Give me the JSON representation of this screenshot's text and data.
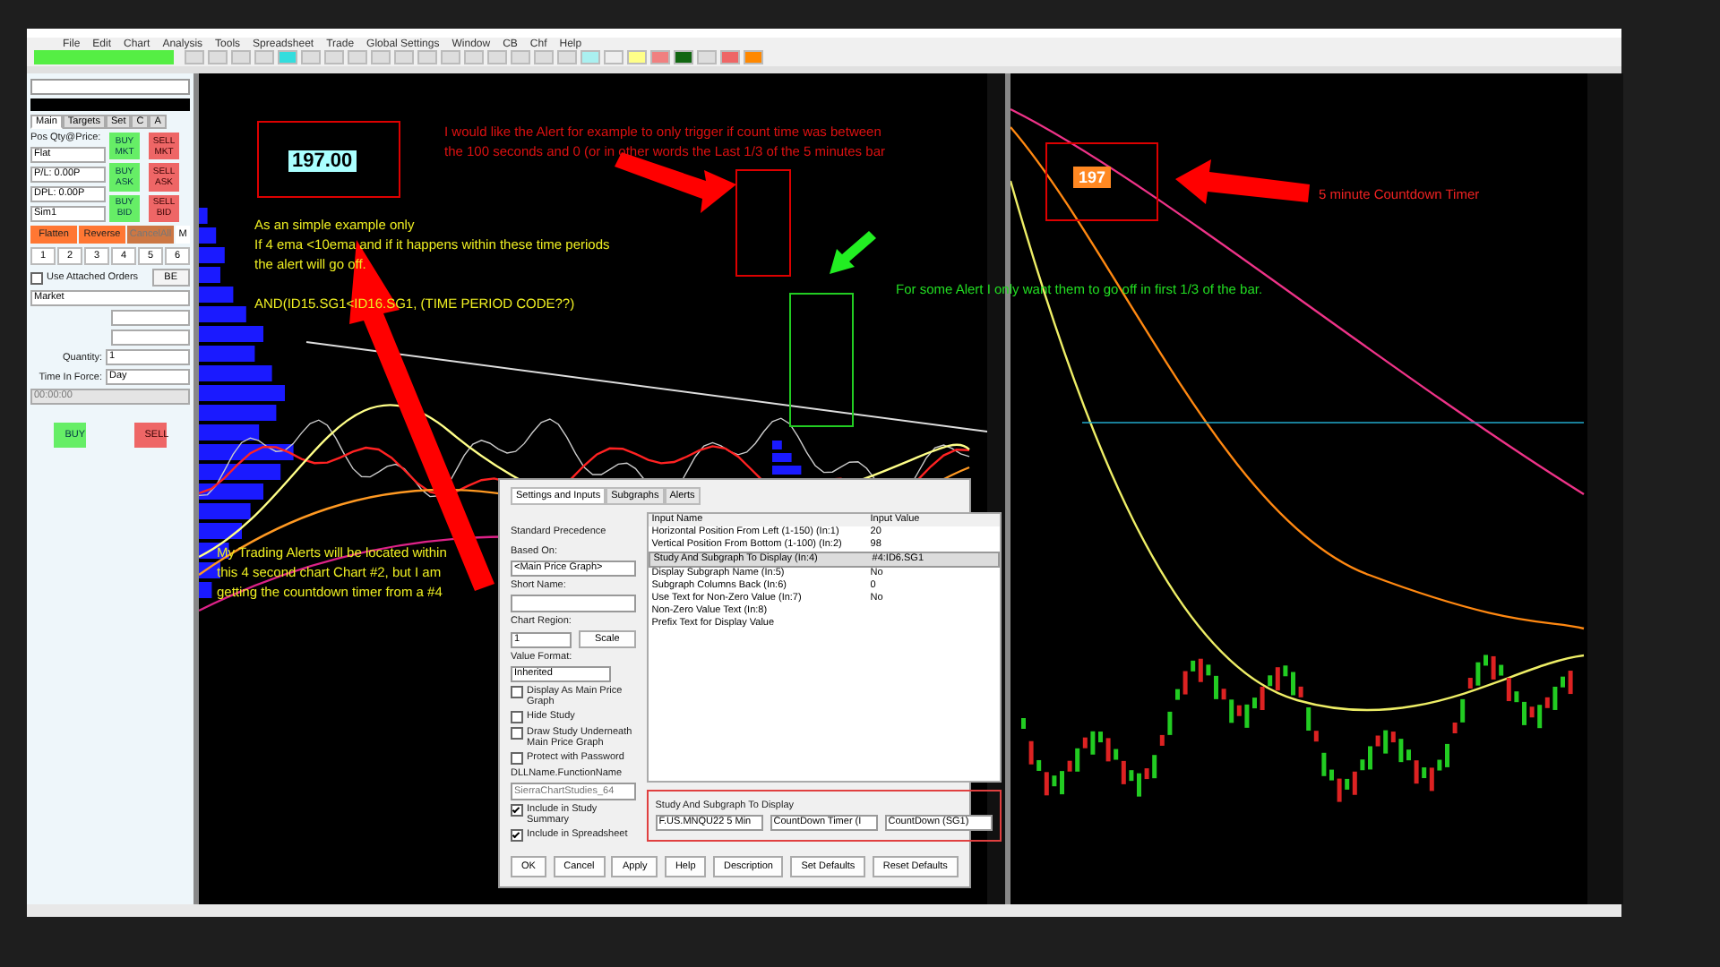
{
  "menu": [
    "File",
    "Edit",
    "Chart",
    "Analysis",
    "Tools",
    "Spreadsheet",
    "Trade",
    "Global Settings",
    "Window",
    "CB",
    "Chf",
    "Help"
  ],
  "order_panel": {
    "tabs": [
      {
        "label": "Main",
        "selected": true
      },
      {
        "label": "Targets",
        "selected": false
      },
      {
        "label": "Set",
        "selected": false
      },
      {
        "label": "C",
        "selected": false
      },
      {
        "label": "A",
        "selected": false
      }
    ],
    "position_label": "Pos Qty@Price:",
    "position_value": "Flat",
    "pl": "P/L: 0.00P",
    "dpl": "DPL: 0.00P",
    "account": "Sim1",
    "trade_buttons": [
      {
        "label": "BUY MKT",
        "kind": "buy"
      },
      {
        "label": "SELL MKT",
        "kind": "sell"
      },
      {
        "label": "BUY ASK",
        "kind": "buy"
      },
      {
        "label": "SELL ASK",
        "kind": "sell"
      },
      {
        "label": "BUY BID",
        "kind": "buy"
      },
      {
        "label": "SELL BID",
        "kind": "sell"
      }
    ],
    "actions": [
      "Flatten",
      "Reverse",
      "CancelAll",
      "M"
    ],
    "numbers": [
      "1",
      "2",
      "3",
      "4",
      "5",
      "6"
    ],
    "attached_orders": {
      "label": "Use Attached Orders",
      "checked": false
    },
    "be": "BE",
    "order_type": "Market",
    "quantity_label": "Quantity:",
    "quantity": "1",
    "tif_label": "Time In Force:",
    "tif": "Day",
    "time": "00:00:00",
    "buy": "BUY",
    "sell": "SELL"
  },
  "left_chart": {
    "price_box": "197.00",
    "note_top": [
      "I would like the Alert for example to only trigger if count time was between",
      "the 100 seconds and 0 (or in other words the Last 1/3 of the 5 minutes bar"
    ],
    "note_example": [
      "As an simple example only",
      "If 4 ema <10ema and if  it happens within these time periods",
      "the alert will go off."
    ],
    "formula": "AND(ID15.SG1<ID16.SG1, (TIME PERIOD CODE??)",
    "note_bottom": [
      "My Trading Alerts will be located within",
      "this 4 second chart Chart #2,  but I am",
      "getting the countdown timer from a #4"
    ]
  },
  "green_note": "For some Alert I only want them to go off in first 1/3 of the bar.",
  "right_chart": {
    "timer": "197",
    "timer_note": "5 minute Countdown Timer"
  },
  "dialog": {
    "tabs": [
      {
        "label": "Settings and Inputs",
        "selected": true
      },
      {
        "label": "Subgraphs",
        "selected": false
      },
      {
        "label": "Alerts",
        "selected": false
      }
    ],
    "precedence": "Standard Precedence",
    "based_on_label": "Based On:",
    "based_on": "<Main Price Graph>",
    "short_name_label": "Short Name:",
    "region_label": "Chart Region:",
    "region": "1",
    "scale": "Scale",
    "format_label": "Value Format:",
    "format": "Inherited",
    "options": [
      {
        "label": "Display As Main Price Graph",
        "checked": false
      },
      {
        "label": "Hide Study",
        "checked": false
      },
      {
        "label": "Draw Study Underneath Main Price Graph",
        "checked": false
      },
      {
        "label": "Protect with Password",
        "checked": false
      }
    ],
    "dll_label": "DLLName.FunctionName",
    "dll": "SierraChartStudies_64",
    "includes": [
      {
        "label": "Include in Study Summary",
        "checked": true
      },
      {
        "label": "Include in Spreadsheet",
        "checked": true
      }
    ],
    "columns": [
      "Input Name",
      "Input Value"
    ],
    "inputs": [
      {
        "name": "Horizontal Position From Left (1-150)  (In:1)",
        "value": "20",
        "selected": false
      },
      {
        "name": "Vertical Position From Bottom (1-100)  (In:2)",
        "value": "98",
        "selected": false
      },
      {
        "name": "Study And Subgraph To Display  (In:4)",
        "value": "#4:ID6.SG1",
        "selected": true
      },
      {
        "name": "Display Subgraph Name  (In:5)",
        "value": "No",
        "selected": false
      },
      {
        "name": "Subgraph Columns Back  (In:6)",
        "value": "0",
        "selected": false
      },
      {
        "name": "Use Text for Non-Zero Value  (In:7)",
        "value": "No",
        "selected": false
      },
      {
        "name": "Non-Zero Value Text  (In:8)",
        "selected": false
      },
      {
        "name": "Prefix Text for Display Value",
        "selected": false
      }
    ],
    "subgraph_label": "Study And Subgraph To Display",
    "subgraph_selects": [
      "F.US.MNQU22  5 Min",
      "CountDown Timer (I",
      "CountDown (SG1)"
    ],
    "buttons": [
      "OK",
      "Cancel",
      "Apply",
      "Help",
      "Description",
      "Set Defaults",
      "Reset Defaults"
    ]
  }
}
